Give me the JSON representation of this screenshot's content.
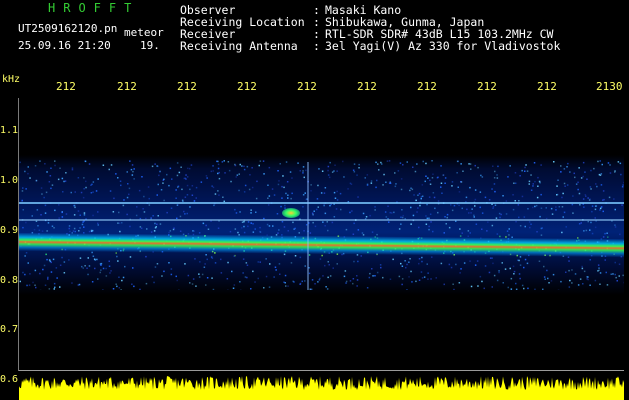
{
  "header": {
    "brand": "HROFFT",
    "filename": "UT2509162120.pn",
    "tag": "meteor",
    "datetime": "25.09.16 21:20",
    "count": "19."
  },
  "info": [
    {
      "key": "Observer",
      "sep": ":",
      "value": "Masaki Kano"
    },
    {
      "key": "Receiving Location",
      "sep": ":",
      "value": "Shibukawa, Gunma, Japan"
    },
    {
      "key": "Receiver",
      "sep": ":",
      "value": "RTL-SDR SDR# 43dB L15 103.2MHz CW"
    },
    {
      "key": "Receiving Antenna",
      "sep": ":",
      "value": "3el Yagi(V) Az 330 for Vladivostok"
    }
  ],
  "axes": {
    "y_unit": "kHz",
    "y_ticks": [
      "1.1",
      "1.0",
      "0.9",
      "0.8",
      "0.7",
      "0.6"
    ],
    "x_ticks": [
      "212",
      "212",
      "212",
      "212",
      "212",
      "212",
      "212",
      "212",
      "212",
      "2130"
    ]
  },
  "colors": {
    "brand": "#33cc33",
    "text": "#ffffff",
    "axis_labels": "#ffff66",
    "power_trace": "#ffff00"
  }
}
